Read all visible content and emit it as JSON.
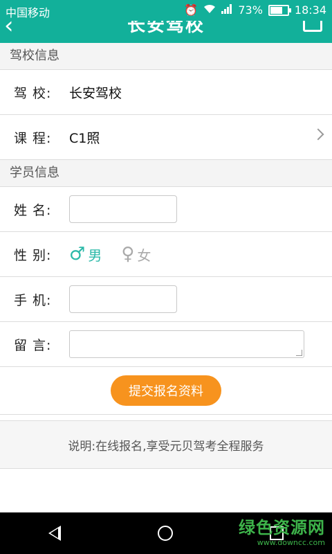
{
  "status_bar": {
    "carrier": "中国移动",
    "battery_text": "73%",
    "time": "18:34",
    "battery_level": 0.73,
    "icons": [
      "alarm-icon",
      "wifi-icon",
      "signal-icon",
      "battery-icon"
    ]
  },
  "header": {
    "title": "长安驾校",
    "back_icon": "chevron-left-icon",
    "share_icon": "share-icon"
  },
  "school_section": {
    "title": "驾校信息",
    "rows": [
      {
        "label": "驾  校:",
        "value": "长安驾校"
      },
      {
        "label": "课  程:",
        "value": "C1照"
      }
    ]
  },
  "student_section": {
    "title": "学员信息",
    "name_label": "姓  名:",
    "name_value": "",
    "gender_label": "性  别:",
    "gender_options": [
      {
        "symbol": "♂",
        "label": "男",
        "selected": true
      },
      {
        "symbol": "♀",
        "label": "女",
        "selected": false
      }
    ],
    "phone_label": "手  机:",
    "phone_value": "",
    "message_label": "留  言:",
    "message_value": ""
  },
  "submit_label": "提交报名资料",
  "note": "说明:在线报名,享受元贝驾考全程服务",
  "colors": {
    "accent": "#12b09a",
    "male": "#2bb9a8",
    "button": "#f7931e",
    "watermark": "#3db34a"
  },
  "watermark": {
    "big": "绿色资源网",
    "small": "www.downcc.com"
  }
}
